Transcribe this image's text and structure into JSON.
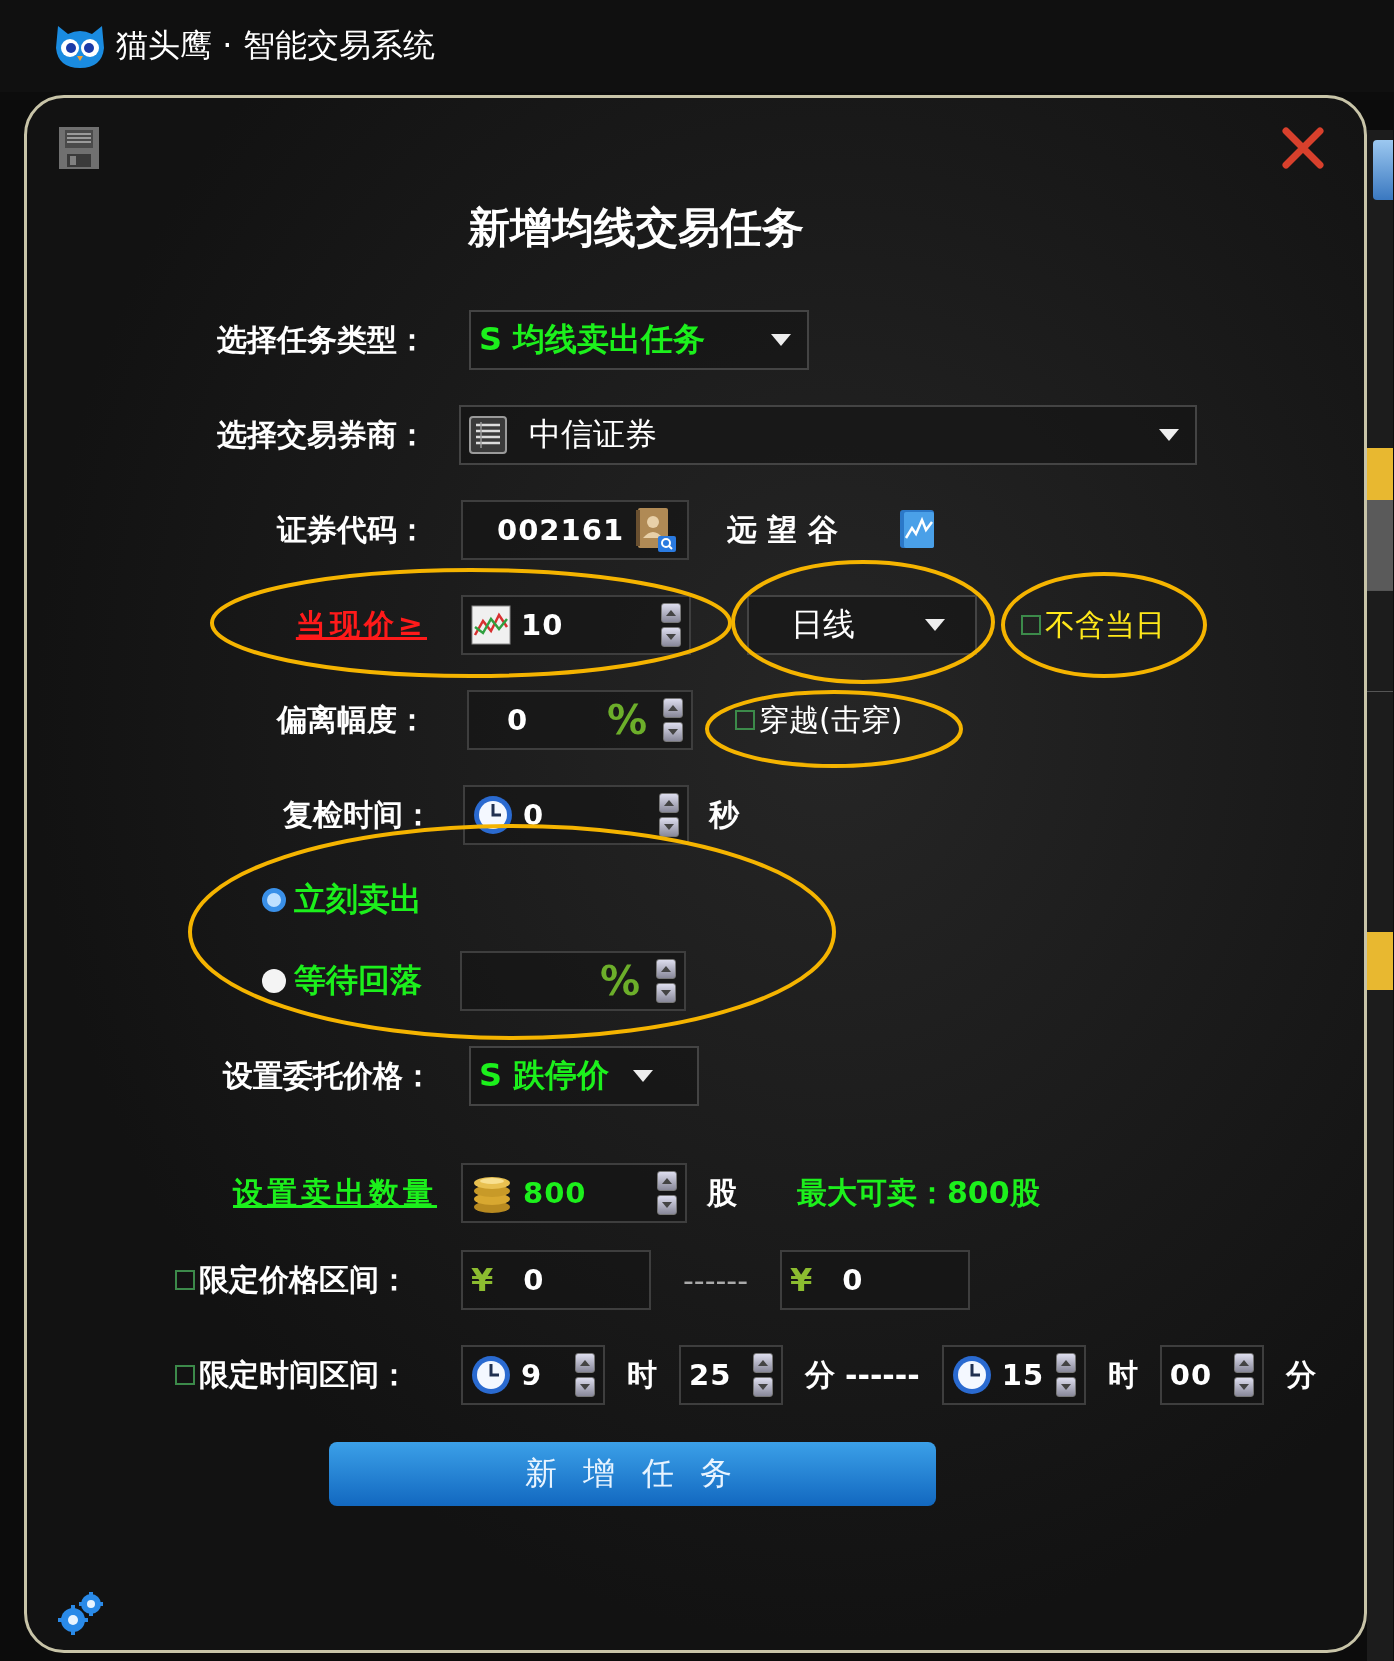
{
  "app": {
    "title": "猫头鹰 · 智能交易系统"
  },
  "dialog": {
    "title": "新增均线交易任务",
    "task_type": {
      "label": "选择任务类型：",
      "value": "S 均线卖出任务"
    },
    "broker": {
      "label": "选择交易券商：",
      "value": "中信证券"
    },
    "stock_code": {
      "label": "证券代码：",
      "value": "002161",
      "name": "远 望 谷"
    },
    "ma_price": {
      "label": "当现价≥",
      "value": "10",
      "period": "日线",
      "exclude_today": {
        "label": "不含当日",
        "checked": false
      }
    },
    "deviation": {
      "label": "偏离幅度：",
      "value": "0",
      "unit": "%",
      "cross": {
        "label": "穿越(击穿)",
        "checked": false
      }
    },
    "recheck": {
      "label": "复检时间：",
      "value": "0",
      "unit": "秒"
    },
    "sell_modes": [
      {
        "label": "立刻卖出",
        "selected": true
      },
      {
        "label": "等待回落",
        "selected": false,
        "unit": "%"
      }
    ],
    "order_price": {
      "label": "设置委托价格：",
      "value": "S 跌停价"
    },
    "quantity": {
      "label": "设置卖出数量",
      "value": "800",
      "unit": "股",
      "max": "最大可卖：800股"
    },
    "price_range": {
      "label": "限定价格区间：",
      "checked": false,
      "from": {
        "symbol": "¥",
        "value": "0"
      },
      "separator": "------",
      "to": {
        "symbol": "¥",
        "value": "0"
      }
    },
    "time_range": {
      "label": "限定时间区间：",
      "checked": false,
      "parts": [
        {
          "kind": "clock_field",
          "value": "9"
        },
        {
          "kind": "unit",
          "text": "时"
        },
        {
          "kind": "field",
          "value": "25"
        },
        {
          "kind": "unit",
          "text": "分"
        },
        {
          "kind": "separator",
          "text": "------"
        },
        {
          "kind": "clock_field",
          "value": "15"
        },
        {
          "kind": "unit",
          "text": "时"
        },
        {
          "kind": "field",
          "value": "00"
        },
        {
          "kind": "unit",
          "text": "分"
        }
      ]
    },
    "submit": "新 增 任 务"
  }
}
